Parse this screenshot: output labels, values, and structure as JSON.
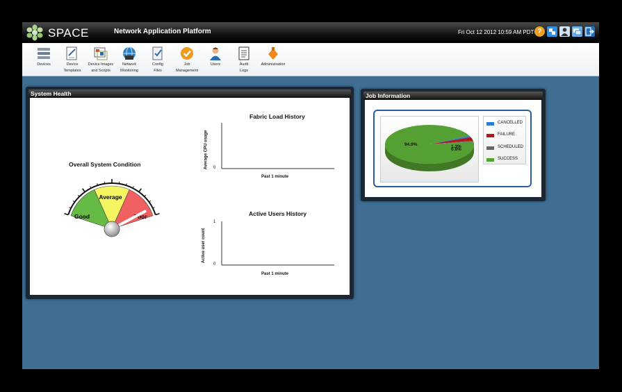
{
  "header": {
    "logo_text": "SPACE",
    "title": "Network Application Platform",
    "datetime": "Fri Oct 12 2012 10:59 AM PDT",
    "help_glyph": "?",
    "icons": [
      "help-icon",
      "settings-icon",
      "user-icon",
      "tasks-icon",
      "logout-icon"
    ]
  },
  "toolbar": {
    "items": [
      {
        "line1": "Devices",
        "line2": "",
        "icon": "devices-icon"
      },
      {
        "line1": "Device",
        "line2": "Templates",
        "icon": "device-templates-icon"
      },
      {
        "line1": "Device Images",
        "line2": "and Scripts",
        "icon": "device-images-icon"
      },
      {
        "line1": "Network",
        "line2": "Monitoring",
        "icon": "network-monitoring-icon"
      },
      {
        "line1": "Config",
        "line2": "Files",
        "icon": "config-files-icon"
      },
      {
        "line1": "Job",
        "line2": "Management",
        "icon": "job-management-icon"
      },
      {
        "line1": "Users",
        "line2": "",
        "icon": "users-icon"
      },
      {
        "line1": "Audit",
        "line2": "Logs",
        "icon": "audit-logs-icon"
      },
      {
        "line1": "Administration",
        "line2": "",
        "icon": "administration-icon"
      }
    ]
  },
  "system_health": {
    "title": "System Health",
    "gauge": {
      "title": "Overall System Condition",
      "labels": [
        "Good",
        "Average",
        "Poor"
      ],
      "value": 0.93,
      "colors": {
        "good": "#66bb44",
        "average": "#f5f562",
        "poor": "#f06060"
      }
    },
    "fabric_load": {
      "title": "Fabric Load History",
      "ylabel": "Average CPU usage",
      "xlabel": "Past 1 minute",
      "y_ticks": [
        "0"
      ]
    },
    "active_users": {
      "title": "Active Users History",
      "ylabel": "Active user count",
      "xlabel": "Past 1 minute",
      "y_ticks": [
        "1",
        "0"
      ]
    }
  },
  "job_information": {
    "title": "Job Information",
    "legend": [
      {
        "label": "CANCELLED",
        "color": "#2a7fd4"
      },
      {
        "label": "FAILURE",
        "color": "#b01818"
      },
      {
        "label": "SCHEDULED",
        "color": "#666666"
      },
      {
        "label": "SUCCESS",
        "color": "#55a032"
      }
    ]
  },
  "chart_data": {
    "type": "pie",
    "title": "",
    "categories": [
      "CANCELLED",
      "FAILURE",
      "SCHEDULED",
      "SUCCESS"
    ],
    "values": [
      1.3,
      3.0,
      0.8,
      94.9
    ],
    "labels": [
      "1.3%",
      "",
      "0.8%",
      "94.9%"
    ],
    "legend": "right"
  }
}
